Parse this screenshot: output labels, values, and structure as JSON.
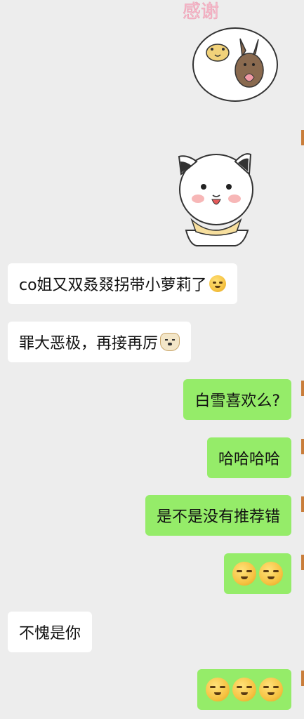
{
  "messages": [
    {
      "side": "in",
      "text": "co姐又双叒叕拐带小萝莉了",
      "emoji": "smirk-emoji"
    },
    {
      "side": "in",
      "text": "罪大恶极，再接再厉",
      "emoji": "dog-emoji"
    },
    {
      "side": "out",
      "text": "白雪喜欢么?"
    },
    {
      "side": "out",
      "text": "哈哈哈哈"
    },
    {
      "side": "out",
      "text": "是不是没有推荐错"
    },
    {
      "side": "out",
      "emoji_only": [
        "smirk-emoji",
        "smirk-emoji"
      ]
    },
    {
      "side": "in",
      "text": "不愧是你"
    },
    {
      "side": "out",
      "emoji_only": [
        "grimace-emoji",
        "grimace-emoji",
        "grimace-emoji"
      ]
    }
  ],
  "stickers": [
    {
      "name": "thank-you-duck-rabbit-sticker",
      "caption": "感谢"
    },
    {
      "name": "white-cat-scarf-sticker"
    }
  ],
  "colors": {
    "background": "#ededed",
    "incoming_bubble": "#ffffff",
    "outgoing_bubble": "#95ec69"
  }
}
